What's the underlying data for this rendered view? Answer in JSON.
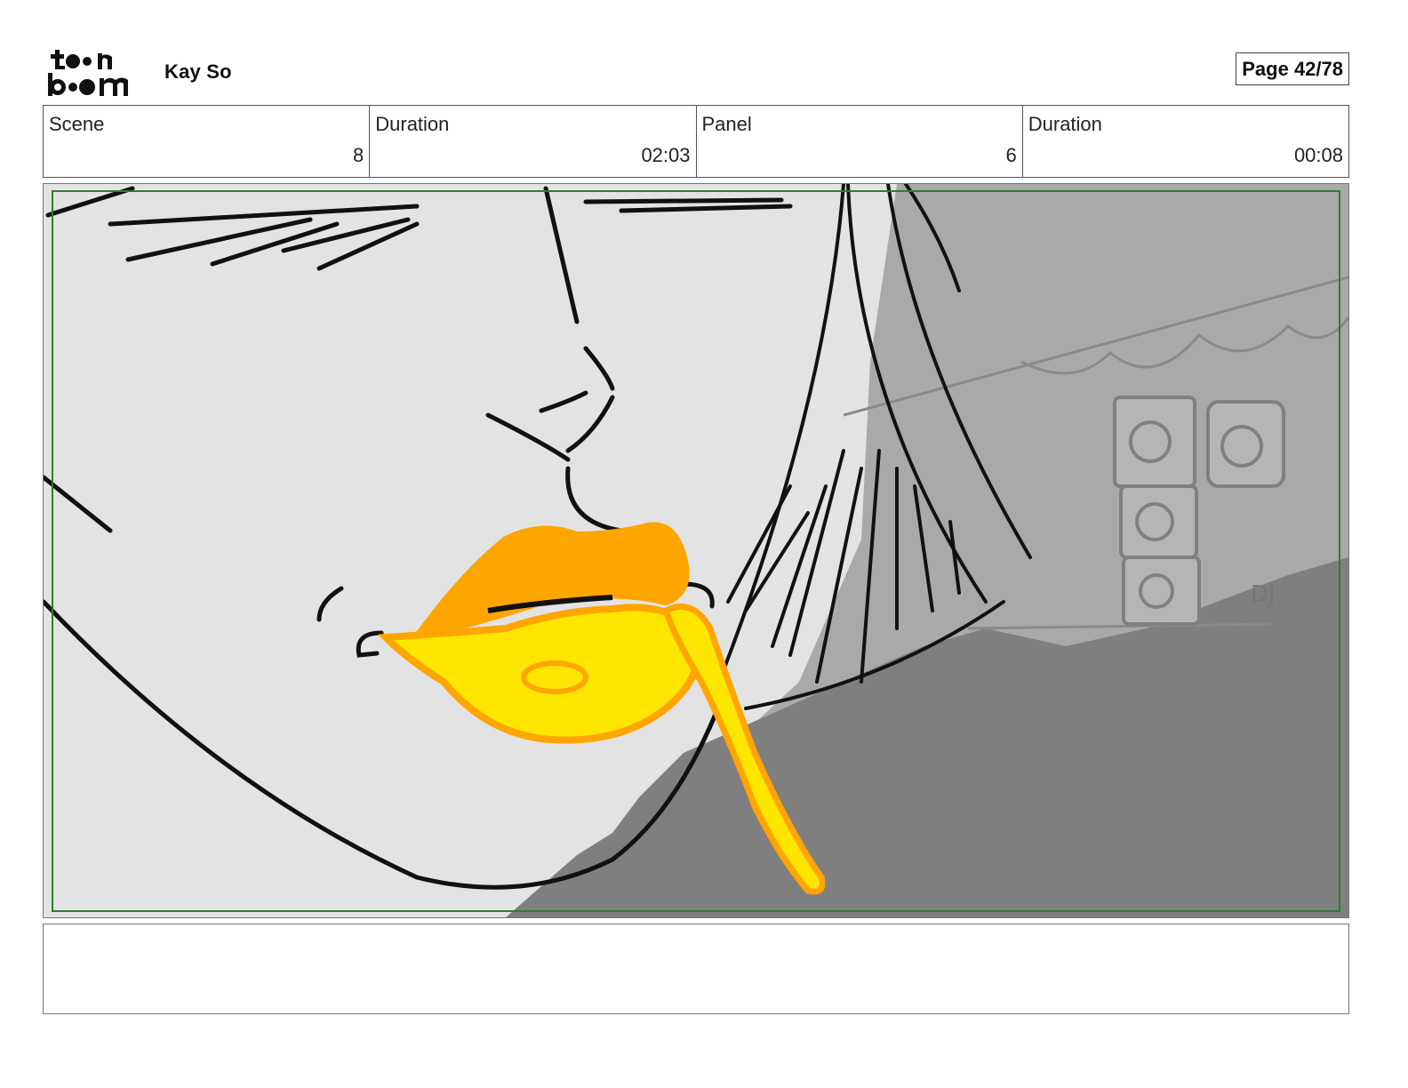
{
  "header": {
    "logo_text": "toon boom",
    "author": "Kay So",
    "page_label": "Page 42/78"
  },
  "info": [
    {
      "label": "Scene",
      "value": "8"
    },
    {
      "label": "Duration",
      "value": "02:03"
    },
    {
      "label": "Panel",
      "value": "6"
    },
    {
      "label": "Duration",
      "value": "00:08"
    }
  ],
  "panel": {
    "frame_color": "#2e7d32",
    "lip_color": "#ffe600",
    "lip_outline_color": "#ffa500",
    "background_color": "#7f7f7f",
    "skin_color": "#e3e3e3"
  },
  "notes": {
    "text": ""
  }
}
